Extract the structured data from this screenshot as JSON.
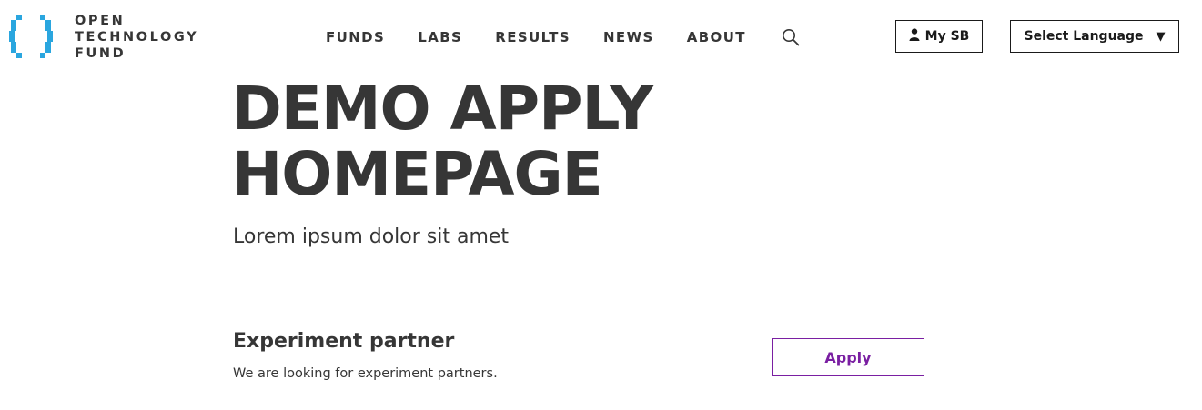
{
  "header": {
    "logo": {
      "lines": [
        "OPEN",
        "TECHNOLOGY",
        "FUND"
      ],
      "mark_color": "#2aa6df",
      "mark_icon": "bracket-logo-icon"
    },
    "nav": {
      "items": [
        {
          "label": "FUNDS"
        },
        {
          "label": "LABS"
        },
        {
          "label": "RESULTS"
        },
        {
          "label": "NEWS"
        },
        {
          "label": "ABOUT"
        }
      ],
      "search_icon": "search-icon"
    },
    "account_button": {
      "label": "My SB",
      "icon": "user-icon"
    },
    "language_select": {
      "selected": "Select Language",
      "caret": "▼"
    }
  },
  "hero": {
    "title_lines": [
      "DEMO APPLY",
      "HOMEPAGE"
    ],
    "subtitle": "Lorem ipsum dolor sit amet"
  },
  "opportunities": [
    {
      "title": "Experiment partner",
      "description": "We are looking for experiment partners.",
      "action_label": "Apply"
    }
  ],
  "colors": {
    "text": "#363636",
    "accent": "#7a1fa2",
    "logo_blue": "#2aa6df"
  }
}
